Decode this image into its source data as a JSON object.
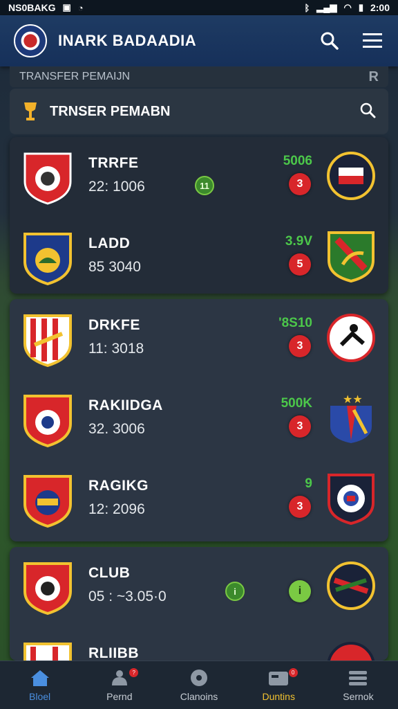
{
  "status_bar": {
    "carrier": "NS0BAKG",
    "time": "2:00"
  },
  "header": {
    "title": "INARK BADAADIA"
  },
  "sub_strip": {
    "label": "TRANSFER PEMAIJN"
  },
  "section": {
    "title": "TRNSER PEMABN"
  },
  "transfers": [
    {
      "name": "TRRFE",
      "meta": "22: 1006",
      "fee": "5006",
      "badge": "3",
      "mid_badge": "11"
    },
    {
      "name": "LADD",
      "meta": "85  3040",
      "fee": "3.9V",
      "badge": "5"
    },
    {
      "name": "DRKFE",
      "meta": "11: 3018",
      "fee": "'8S10",
      "badge": "3"
    },
    {
      "name": "RAKIIDGA",
      "meta": "32. 3006",
      "fee": "500K",
      "badge": "3"
    },
    {
      "name": "RAGIKG",
      "meta": "12: 2096",
      "fee": "9",
      "badge": "3"
    },
    {
      "name": "CLUB",
      "meta": "05 : ~3.05·0",
      "badge": "i",
      "mid_badge": "i"
    },
    {
      "name": "RLIIBB"
    }
  ],
  "nav": [
    {
      "label": "Bloel"
    },
    {
      "label": "Pernd",
      "dot": "?"
    },
    {
      "label": "Clanoins"
    },
    {
      "label": "Duntins",
      "dot": "0"
    },
    {
      "label": "Sernok"
    }
  ],
  "colors": {
    "accent_fee": "#4cc84a",
    "badge_red": "#d8262a",
    "nav_active": "#f2c230",
    "header_blue": "#1e3b63"
  }
}
